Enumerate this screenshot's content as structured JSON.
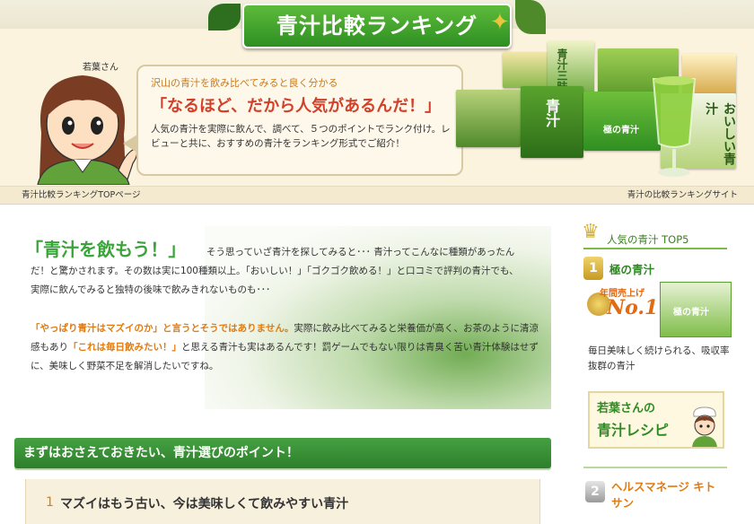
{
  "header": {
    "title": "青汁比較ランキング",
    "girl_name": "若葉さん",
    "lead": "沢山の青汁を飲み比べてみると良く分かる",
    "headline": "「なるほど、だから人気があるんだ！」",
    "body": "人気の青汁を実際に飲んで、調べて、５つのポイントでランク付け。レビューと共に、おすすめの青汁をランキング形式でご紹介！",
    "products": [
      "青汁三昧",
      "青汁",
      "極の青汁",
      "おいしい青汁"
    ]
  },
  "strip": {
    "breadcrumb": "青汁比較ランキングTOPページ",
    "site_tag": "青汁の比較ランキングサイト"
  },
  "main": {
    "intro_heading": "「青汁を飲もう！」",
    "intro_p1": "そう思っていざ青汁を探してみると･･･ 青汁ってこんなに種類があったんだ！と驚かされます。その数は実に100種類以上。「おいしい！」「ゴクゴク飲める！」と口コミで評判の青汁でも、実際に飲んでみると独特の後味で飲みきれないものも･･･",
    "intro_p2_hl1": "「やっぱり青汁はマズイのか」と言うとそうではありません。",
    "intro_p2_a": "実際に飲み比べてみると栄養価が高く、お茶のように清涼感もあり",
    "intro_p2_hl2": "「これは毎日飲みたい！」",
    "intro_p2_b": "と思える青汁も実はあるんです！罰ゲームでもない限りは青臭く苦い青汁体験はせずに、美味しく野菜不足を解消したいですね。",
    "section_heading": "まずはおさえておきたい、青汁選びのポイント！",
    "point_num": "1",
    "point_text": "マズイはもう古い、今は美味しくて飲みやすい青汁"
  },
  "sidebar": {
    "heading": "人気の青汁 TOP5",
    "rank1_num": "1",
    "rank1_name": "極の青汁",
    "award_top": "年間売上げ",
    "award_no1": "No.1",
    "rank1_product": "極の青汁",
    "rank1_desc": "毎日美味しく続けられる、吸収率抜群の青汁",
    "recipe_l1": "若葉さんの",
    "recipe_l2": "青汁レシピ",
    "rank2_num": "2",
    "rank2_name": "ヘルスマネージ キトサン"
  },
  "colors": {
    "brand_green": "#2f8f22",
    "accent_orange": "#e07b12",
    "headline_red": "#d2402a"
  }
}
